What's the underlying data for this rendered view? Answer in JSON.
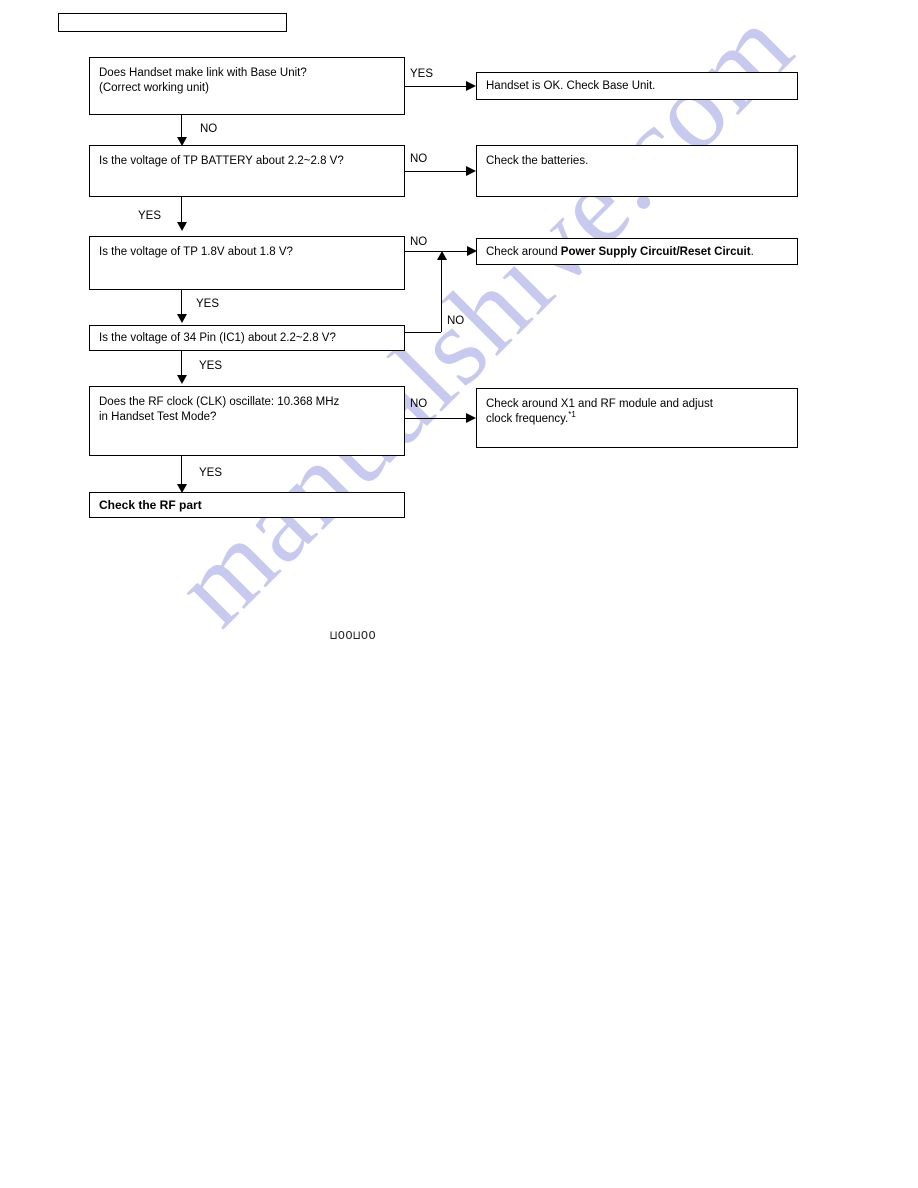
{
  "page": {
    "header_box_label": "",
    "page_mark": "⊔OO⊔OO",
    "watermark": "manualshive.com",
    "watermark_color": "#c8c9ef",
    "background_color": "#ffffff",
    "line_color": "#000000"
  },
  "flow": {
    "decisions": [
      {
        "id": "d1",
        "text": "Does Handset make link with Base Unit?\n(Correct working unit)",
        "yes_label": "YES",
        "no_label": "NO"
      },
      {
        "id": "d2",
        "text": "Is the voltage of TP BATTERY about 2.2~2.8 V?",
        "yes_label": "YES",
        "no_label": "NO"
      },
      {
        "id": "d3",
        "text": "Is the voltage of TP 1.8V about 1.8 V?",
        "yes_label": "YES",
        "no_label": "NO"
      },
      {
        "id": "d4",
        "text": "Is the voltage of 34 Pin (IC1) about 2.2~2.8 V?",
        "yes_label": "YES",
        "no_label": "NO"
      },
      {
        "id": "d5",
        "text": "Does the RF clock (CLK) oscillate: 10.368 MHz\nin Handset Test Mode?",
        "yes_label": "YES",
        "no_label": "NO"
      }
    ],
    "actions": [
      {
        "id": "a1",
        "text": "Handset is OK. Check Base Unit."
      },
      {
        "id": "a2",
        "text": "Check the batteries."
      },
      {
        "id": "a3",
        "text_prefix": "Check around ",
        "text_bold": "Power Supply Circuit/Reset Circuit",
        "text_suffix": "."
      },
      {
        "id": "a4",
        "text_line1": "Check around X1 and RF module and adjust",
        "text_line2": "clock frequency.",
        "footnote_mark": "*1"
      }
    ],
    "terminal": {
      "id": "t1",
      "text": "Check the RF part"
    }
  }
}
